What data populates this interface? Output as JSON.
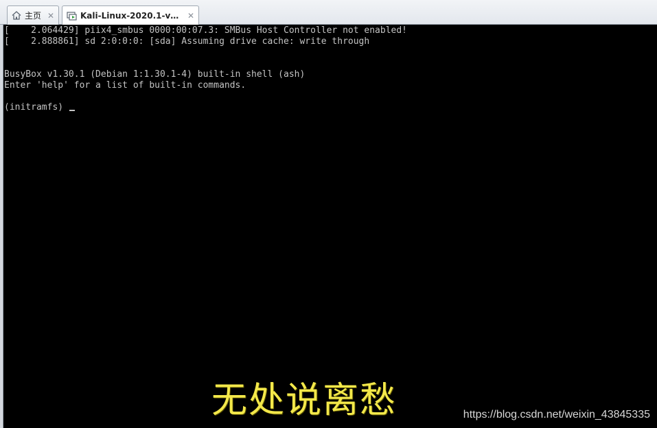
{
  "tabs": [
    {
      "label": "主页",
      "icon": "home-icon",
      "active": false
    },
    {
      "label": "Kali-Linux-2020.1-vmwar...",
      "icon": "vm-icon",
      "active": true
    }
  ],
  "close_glyph": "✕",
  "console": {
    "lines": [
      "[    2.064429] piix4_smbus 0000:00:07.3: SMBus Host Controller not enabled!",
      "[    2.888861] sd 2:0:0:0: [sda] Assuming drive cache: write through",
      "",
      "",
      "BusyBox v1.30.1 (Debian 1:1.30.1-4) built-in shell (ash)",
      "Enter 'help' for a list of built-in commands.",
      ""
    ],
    "prompt": "(initramfs) "
  },
  "subtitle": "无处说离愁",
  "watermark": "https://blog.csdn.net/weixin_43845335",
  "colors": {
    "console_bg": "#000000",
    "console_text": "#c4c4c4",
    "subtitle": "#f3e84a"
  }
}
